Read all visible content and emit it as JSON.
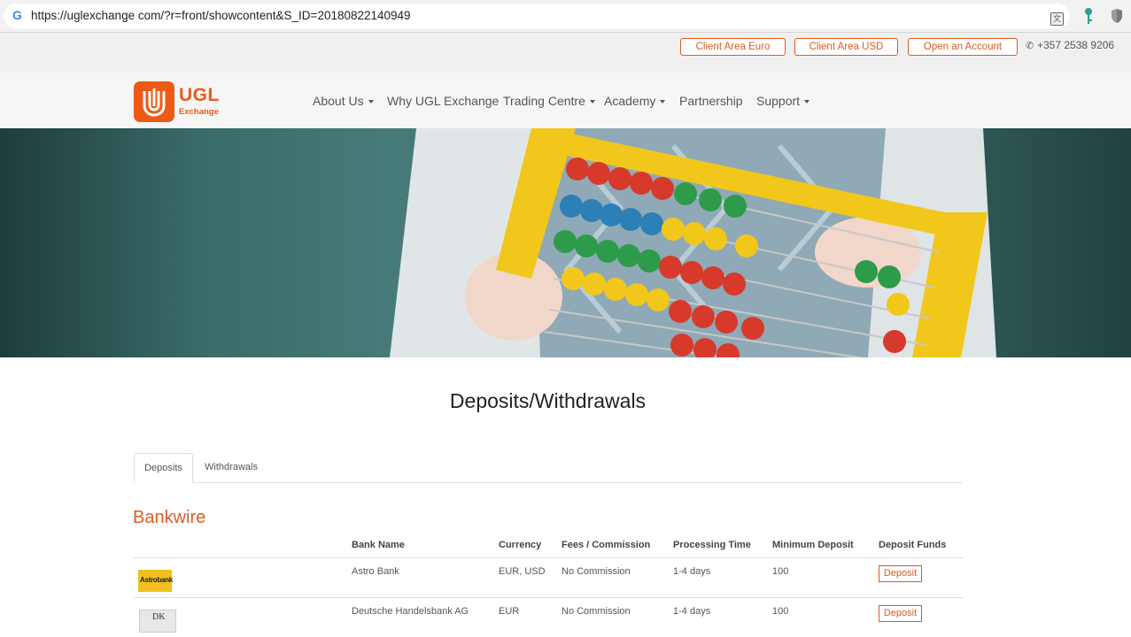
{
  "browser": {
    "url": "https://uglexchange com/?r=front/showcontent&S_ID=20180822140949"
  },
  "topbar": {
    "buttons": [
      "Client Area Euro",
      "Client Area USD",
      "Open an Account"
    ],
    "phone": "+357 2538 9206"
  },
  "nav": {
    "logo_text": "UGL",
    "logo_sub": "Exchange",
    "items": [
      "About Us",
      "Why UGL Exchange",
      "Trading Centre",
      "Academy",
      "Partnership",
      "Support"
    ]
  },
  "page": {
    "title": "Deposits/Withdrawals",
    "tabs": [
      "Deposits",
      "Withdrawals"
    ],
    "section_title": "Bankwire"
  },
  "table": {
    "headers": [
      "Bank Name",
      "Currency",
      "Fees / Commission",
      "Processing Time",
      "Minimum Deposit",
      "Deposit Funds"
    ],
    "rows": [
      {
        "logo": "Astrobank",
        "bank": "Astro Bank",
        "currency": "EUR, USD",
        "fees": "No Commission",
        "time": "1-4 days",
        "min": "100",
        "action": "Deposit"
      },
      {
        "logo": "DK",
        "bank": "Deutsche Handelsbank AG",
        "currency": "EUR",
        "fees": "No Commission",
        "time": "1-4 days",
        "min": "100",
        "action": "Deposit"
      }
    ]
  },
  "colors": {
    "accent": "#e05a1e",
    "logo_orange": "#ee5a16",
    "hero_green": "#3a6c69",
    "abacus_yellow": "#f2c71b"
  }
}
